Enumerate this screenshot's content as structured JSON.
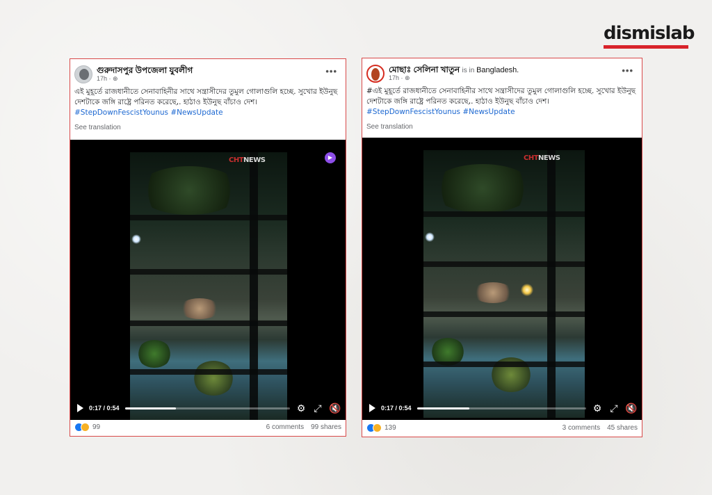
{
  "brand": {
    "name": "dismislab",
    "accent": "#d8232a"
  },
  "posts": [
    {
      "author": "গুরুদাসপুর উপজেলা যুবলীগ",
      "location_prefix": "",
      "location": "",
      "time": "17h · ",
      "text": "এই মুহূর্তে রাজধানীতে সেনাবাহিনীর সাথে সন্ত্রাসীদের তুমুল গোলাগুলি হচ্ছে. সুখোর ইউনুছ দেশটাকে জঙ্গি রাষ্ট্রে পরিনত করেছে,. হাঠাও ইউনুছ বাঁচাও দেশ।",
      "hashtags": "#StepDownFescistYounus #NewsUpdate",
      "see_translation": "See translation",
      "watermark": "CHT",
      "watermark_suffix": "NEWS",
      "video_time": "0:17 / 0:54",
      "progress": 0.31,
      "reactions": "99",
      "comments": "6 comments",
      "shares": "99 shares"
    },
    {
      "author": "মোছাঃ সেলিনা খাতুন",
      "location_prefix": "is in ",
      "location": "Bangladesh.",
      "time": "17h · ",
      "text": "#এই মুহূর্তে রাজধানীতে সেনাবাহিনীর সাথে সন্ত্রাসীদের তুমুল গোলাগুলি হচ্ছে. সুখোর ইউনুছ দেশটাকে জঙ্গি রাষ্ট্রে পরিনত করেছে,. হাঠাও ইউনুছ বাঁচাও দেশ।",
      "hashtags": "#StepDownFescistYounus #NewsUpdate",
      "see_translation": "See translation",
      "watermark": "CHT",
      "watermark_suffix": "NEWS",
      "video_time": "0:17 / 0:54",
      "progress": 0.31,
      "reactions": "139",
      "comments": "3 comments",
      "shares": "45 shares"
    }
  ]
}
